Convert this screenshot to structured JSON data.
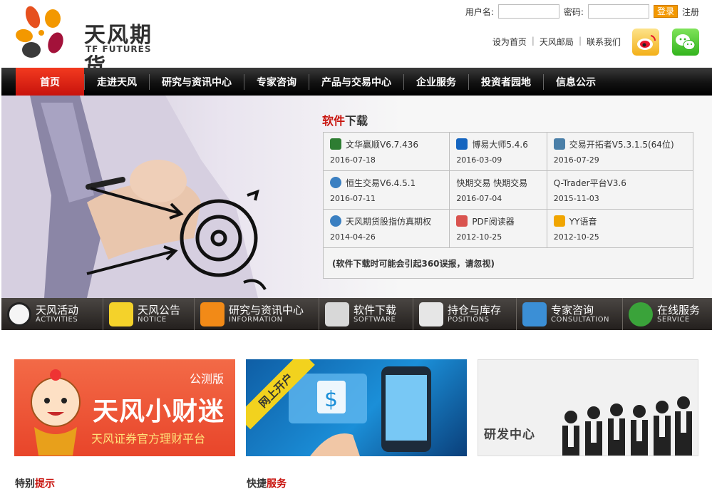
{
  "header": {
    "logo_cn": "天风期货",
    "logo_en": "TF FUTURES",
    "login": {
      "username_label": "用户名:",
      "password_label": "密码:",
      "login_button": "登录",
      "register_link": "注册"
    },
    "toplinks": [
      "设为首页",
      "天风邮局",
      "联系我们"
    ],
    "social": [
      "weibo-icon",
      "wechat-icon"
    ]
  },
  "nav": {
    "items": [
      "首页",
      "走进天风",
      "研究与资讯中心",
      "专家咨询",
      "产品与交易中心",
      "企业服务",
      "投资者园地",
      "信息公示"
    ]
  },
  "downloads": {
    "title_red": "软件",
    "title_rest": "下载",
    "items": [
      {
        "name": "文华赢顺V6.7.436",
        "date": "2016-07-18",
        "icon": "wenhua-icon",
        "color": "#2e7d32"
      },
      {
        "name": "博易大师5.4.6",
        "date": "2016-03-09",
        "icon": "boyi-icon",
        "color": "#1565c0"
      },
      {
        "name": "交易开拓者V5.3.1.5(64位)",
        "date": "2016-07-29",
        "icon": "tb-icon",
        "color": "#4a7fa8"
      },
      {
        "name": "恒生交易V6.4.5.1",
        "date": "2016-07-11",
        "icon": "hundsun-icon",
        "color": "#3a7fc1"
      },
      {
        "name": "快期交易 快期交易",
        "date": "2016-07-04",
        "icon": "",
        "color": ""
      },
      {
        "name": "Q-Trader平台V3.6",
        "date": "2015-11-03",
        "icon": "",
        "color": ""
      },
      {
        "name": "天风期货股指仿真期权",
        "date": "2014-04-26",
        "icon": "hundsun-icon",
        "color": "#3a7fc1"
      },
      {
        "name": "PDF阅读器",
        "date": "2012-10-25",
        "icon": "pdf-icon",
        "color": "#d9534f"
      },
      {
        "name": "YY语音",
        "date": "2012-10-25",
        "icon": "yy-icon",
        "color": "#f0a500"
      }
    ],
    "note": "(软件下载时可能会引起360误报，请忽视)"
  },
  "quickbar": [
    {
      "cn": "天风活动",
      "en": "ACTIVITIES",
      "icon": "clock-icon",
      "color": "#f5f5f5"
    },
    {
      "cn": "天风公告",
      "en": "NOTICE",
      "icon": "notepad-icon",
      "color": "#f4d22a"
    },
    {
      "cn": "研究与资讯中心",
      "en": "INFORMATION",
      "icon": "rss-icon",
      "color": "#f28a17"
    },
    {
      "cn": "软件下载",
      "en": "SOFTWARE",
      "icon": "download-icon",
      "color": "#d8d8d8"
    },
    {
      "cn": "持仓与库存",
      "en": "POSITIONS",
      "icon": "chart-icon",
      "color": "#e6e6e6"
    },
    {
      "cn": "专家咨询",
      "en": "CONSULTATION",
      "icon": "expert-icon",
      "color": "#3b8fd6"
    },
    {
      "cn": "在线服务",
      "en": "SERVICE",
      "icon": "phone-icon",
      "color": "#3aa33a"
    }
  ],
  "banners": {
    "b1": {
      "tag": "公测版",
      "big": "天风小财迷",
      "small": "天风证券官方理财平台"
    },
    "b2": {
      "ribbon": "网上开户"
    },
    "b3": {
      "label": "研发中心"
    }
  },
  "sections": {
    "s1": {
      "plain": "特别",
      "red": "提示"
    },
    "s2": {
      "plain": "快捷",
      "red": "服务"
    }
  }
}
